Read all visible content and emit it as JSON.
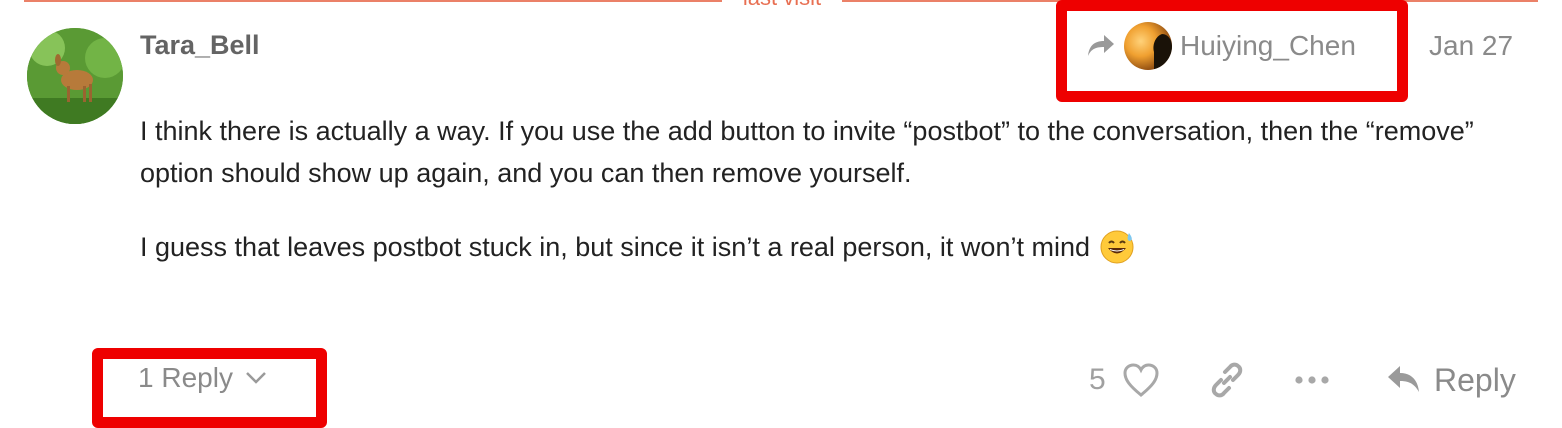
{
  "divider": {
    "label": "last visit"
  },
  "post": {
    "username": "Tara_Bell",
    "reply_to": {
      "name": "Huiying_Chen"
    },
    "date": "Jan 27",
    "paragraphs": [
      "I think there is actually a way. If you use the add button to invite “postbot” to the conversation, then the “remove” option should show up again, and you can then remove yourself.",
      "I guess that leaves postbot stuck in, but since it isn’t a real person, it won’t mind"
    ],
    "emoji": "sweat-smile-emoji"
  },
  "footer": {
    "replies_label": "1 Reply",
    "like_count": "5",
    "reply_label": "Reply"
  },
  "icons": {
    "share": "share-arrow-icon",
    "chevron": "chevron-down-icon",
    "like": "heart-icon",
    "link": "link-icon",
    "more": "ellipsis-icon",
    "reply": "reply-arrow-icon"
  },
  "colors": {
    "divider": "#e45735",
    "annotation": "#ee0000",
    "muted_text": "#8a8a8a",
    "username": "#646464",
    "body_text": "#222222"
  }
}
